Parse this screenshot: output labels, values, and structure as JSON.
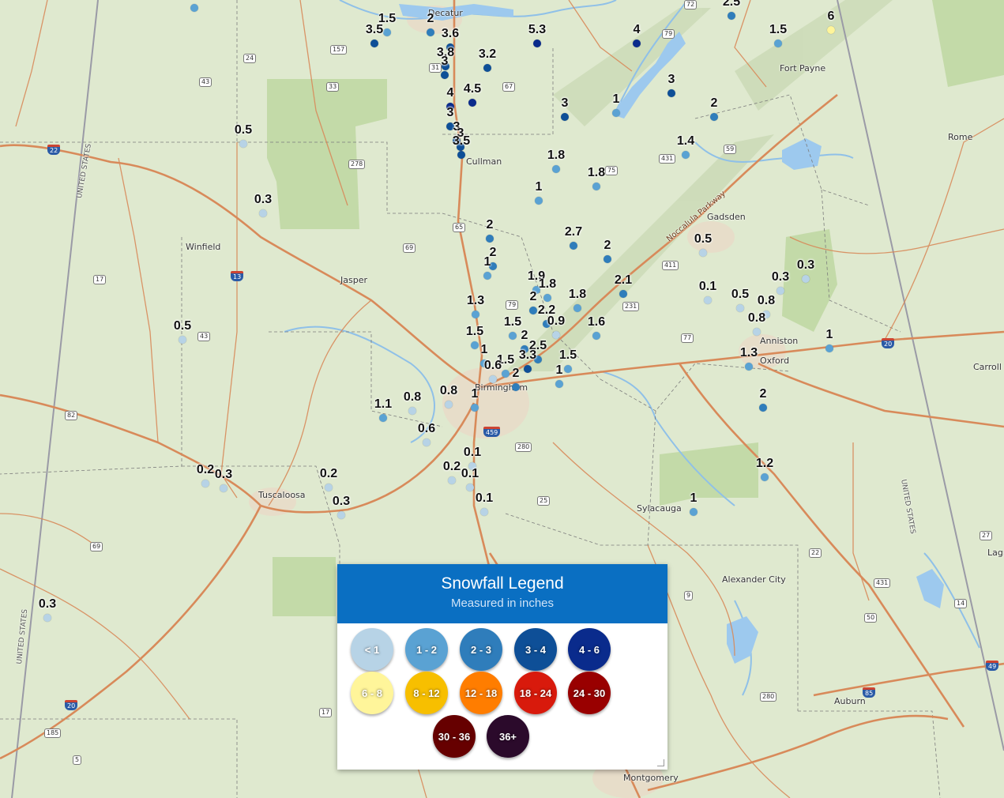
{
  "legend": {
    "title": "Snowfall Legend",
    "subtitle": "Measured in inches",
    "classes": [
      {
        "label": "< 1",
        "color": "#b7d3e6"
      },
      {
        "label": "1 - 2",
        "color": "#5aa2d3"
      },
      {
        "label": "2 - 3",
        "color": "#2f7dbb"
      },
      {
        "label": "3 - 4",
        "color": "#0e4f97"
      },
      {
        "label": "4 - 6",
        "color": "#0a2b8c"
      },
      {
        "label": "6 - 8",
        "color": "#fff59a"
      },
      {
        "label": "8 - 12",
        "color": "#f7bf00"
      },
      {
        "label": "12 - 18",
        "color": "#ff7d00"
      },
      {
        "label": "18 - 24",
        "color": "#d81a0c"
      },
      {
        "label": "24 - 30",
        "color": "#990000"
      },
      {
        "label": "30 - 36",
        "color": "#660000"
      },
      {
        "label": "36+",
        "color": "#2b0a2b"
      }
    ]
  },
  "places": [
    "Decatur",
    "Fort Payne",
    "Rome",
    "Cullman",
    "Gadsden",
    "Winfield",
    "Jasper",
    "Anniston",
    "Oxford",
    "Carroll",
    "Birmingham",
    "Tuscaloosa",
    "Sylacauga",
    "Alexander City",
    "Auburn",
    "Montgomery",
    "Lagr"
  ],
  "road_shields": [
    "72",
    "79",
    "157",
    "24",
    "43",
    "33",
    "31",
    "67",
    "59",
    "431",
    "75",
    "278",
    "22",
    "65",
    "69",
    "411",
    "13",
    "17",
    "79",
    "231",
    "77",
    "20",
    "43",
    "82",
    "459",
    "280",
    "25",
    "27",
    "22",
    "431",
    "9",
    "50",
    "69",
    "14",
    "85",
    "280",
    "49",
    "185",
    "17",
    "5",
    "20",
    "80",
    "20"
  ],
  "road_labels": [
    "Noccalula Parkway",
    "UNITED STATES",
    "UNITED STATES",
    "UNITED STATES"
  ],
  "observations": [
    {
      "value": "2",
      "color": "#5aa2d3"
    },
    {
      "value": "1.5",
      "color": "#5aa2d3"
    },
    {
      "value": "3.5",
      "color": "#0e4f97"
    },
    {
      "value": "2",
      "color": "#2f7dbb"
    },
    {
      "value": "3.6",
      "color": "#0e4f97"
    },
    {
      "value": "3.8",
      "color": "#0e4f97"
    },
    {
      "value": "3",
      "color": "#0e4f97"
    },
    {
      "value": "3.2",
      "color": "#0e4f97"
    },
    {
      "value": "5.3",
      "color": "#0a2b8c"
    },
    {
      "value": "4",
      "color": "#0a2b8c"
    },
    {
      "value": "2.5",
      "color": "#2f7dbb"
    },
    {
      "value": "6",
      "color": "#fff59a"
    },
    {
      "value": "1.5",
      "color": "#5aa2d3"
    },
    {
      "value": "3",
      "color": "#0e4f97"
    },
    {
      "value": "4",
      "color": "#0a2b8c"
    },
    {
      "value": "4.5",
      "color": "#0a2b8c"
    },
    {
      "value": "3",
      "color": "#0e4f97"
    },
    {
      "value": "1",
      "color": "#5aa2d3"
    },
    {
      "value": "3",
      "color": "#0e4f97"
    },
    {
      "value": "2",
      "color": "#2f7dbb"
    },
    {
      "value": "3",
      "color": "#0e4f97"
    },
    {
      "value": "3",
      "color": "#0e4f97"
    },
    {
      "value": "3.5",
      "color": "#0e4f97"
    },
    {
      "value": "1.8",
      "color": "#5aa2d3"
    },
    {
      "value": "1.8",
      "color": "#5aa2d3"
    },
    {
      "value": "1.4",
      "color": "#5aa2d3"
    },
    {
      "value": "0.5",
      "color": "#b7d3e6"
    },
    {
      "value": "0.3",
      "color": "#b7d3e6"
    },
    {
      "value": "1",
      "color": "#5aa2d3"
    },
    {
      "value": "2",
      "color": "#2f7dbb"
    },
    {
      "value": "2",
      "color": "#2f7dbb"
    },
    {
      "value": "2.7",
      "color": "#2f7dbb"
    },
    {
      "value": "2",
      "color": "#2f7dbb"
    },
    {
      "value": "1",
      "color": "#5aa2d3"
    },
    {
      "value": "0.5",
      "color": "#b7d3e6"
    },
    {
      "value": "1.9",
      "color": "#5aa2d3"
    },
    {
      "value": "1.8",
      "color": "#5aa2d3"
    },
    {
      "value": "2.1",
      "color": "#2f7dbb"
    },
    {
      "value": "1.8",
      "color": "#5aa2d3"
    },
    {
      "value": "1.3",
      "color": "#5aa2d3"
    },
    {
      "value": "2",
      "color": "#2f7dbb"
    },
    {
      "value": "2.2",
      "color": "#2f7dbb"
    },
    {
      "value": "0.1",
      "color": "#b7d3e6"
    },
    {
      "value": "0.5",
      "color": "#b7d3e6"
    },
    {
      "value": "0.3",
      "color": "#b7d3e6"
    },
    {
      "value": "0.3",
      "color": "#b7d3e6"
    },
    {
      "value": "0.8",
      "color": "#b7d3e6"
    },
    {
      "value": "0.8",
      "color": "#b7d3e6"
    },
    {
      "value": "1.5",
      "color": "#5aa2d3"
    },
    {
      "value": "0.9",
      "color": "#b7d3e6"
    },
    {
      "value": "1.6",
      "color": "#5aa2d3"
    },
    {
      "value": "0.5",
      "color": "#b7d3e6"
    },
    {
      "value": "1.5",
      "color": "#5aa2d3"
    },
    {
      "value": "2",
      "color": "#2f7dbb"
    },
    {
      "value": "1",
      "color": "#5aa2d3"
    },
    {
      "value": "2.5",
      "color": "#2f7dbb"
    },
    {
      "value": "1",
      "color": "#5aa2d3"
    },
    {
      "value": "1.5",
      "color": "#5aa2d3"
    },
    {
      "value": "3.3",
      "color": "#0e4f97"
    },
    {
      "value": "1",
      "color": "#5aa2d3"
    },
    {
      "value": "1.5",
      "color": "#5aa2d3"
    },
    {
      "value": "1.3",
      "color": "#5aa2d3"
    },
    {
      "value": "0.6",
      "color": "#b7d3e6"
    },
    {
      "value": "2",
      "color": "#2f7dbb"
    },
    {
      "value": "1",
      "color": "#5aa2d3"
    },
    {
      "value": "2",
      "color": "#2f7dbb"
    },
    {
      "value": "1.1",
      "color": "#5aa2d3"
    },
    {
      "value": "0.8",
      "color": "#b7d3e6"
    },
    {
      "value": "0.8",
      "color": "#b7d3e6"
    },
    {
      "value": "0.6",
      "color": "#b7d3e6"
    },
    {
      "value": "0.1",
      "color": "#b7d3e6"
    },
    {
      "value": "0.2",
      "color": "#b7d3e6"
    },
    {
      "value": "0.1",
      "color": "#b7d3e6"
    },
    {
      "value": "0.1",
      "color": "#b7d3e6"
    },
    {
      "value": "0.2",
      "color": "#b7d3e6"
    },
    {
      "value": "0.3",
      "color": "#b7d3e6"
    },
    {
      "value": "0.2",
      "color": "#b7d3e6"
    },
    {
      "value": "0.3",
      "color": "#b7d3e6"
    },
    {
      "value": "1.2",
      "color": "#5aa2d3"
    },
    {
      "value": "1",
      "color": "#5aa2d3"
    },
    {
      "value": "0.3",
      "color": "#b7d3e6"
    }
  ]
}
